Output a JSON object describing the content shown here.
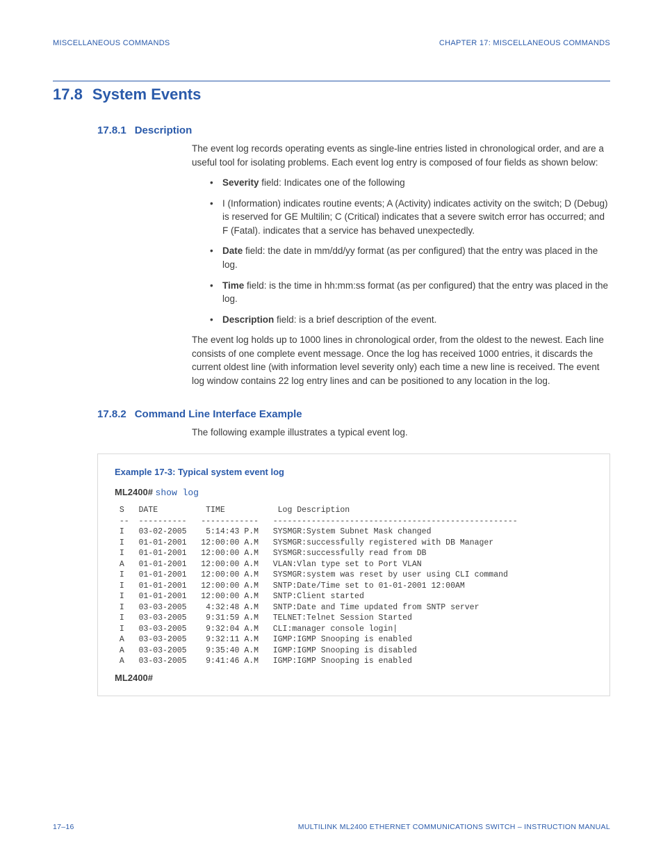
{
  "header": {
    "left": "MISCELLANEOUS COMMANDS",
    "right": "CHAPTER 17: MISCELLANEOUS COMMANDS"
  },
  "section": {
    "number": "17.8",
    "title": "System Events"
  },
  "sub1": {
    "number": "17.8.1",
    "title": "Description",
    "para1": "The event log records operating events as single-line entries listed in chronological order, and are a useful tool for isolating problems. Each event log entry is composed of four fields as shown below:",
    "bullets": [
      {
        "bold": "Severity",
        "rest": " field: Indicates one of the following"
      },
      {
        "bold": "",
        "rest": "I (Information) indicates routine events; A (Activity) indicates activity on the switch; D (Debug) is reserved for GE Multilin; C (Critical) indicates that a severe switch error has occurred; and F (Fatal). indicates that a service has behaved unexpectedly."
      },
      {
        "bold": "Date",
        "rest": " field: the date in mm/dd/yy format (as per configured) that the entry was placed in the log."
      },
      {
        "bold": "Time",
        "rest": " field: is the time in hh:mm:ss format (as per configured) that the entry was placed in the log."
      },
      {
        "bold": "Description",
        "rest": " field: is a brief description of the event."
      }
    ],
    "para2": "The event log holds up to 1000 lines in chronological order, from the oldest to the newest. Each line consists of one complete event message. Once the log has received 1000 entries, it discards the current oldest line (with information level severity only) each time a new line is received. The event log window contains 22 log entry lines and can be positioned to any location in the log."
  },
  "sub2": {
    "number": "17.8.2",
    "title": "Command Line Interface Example",
    "para1": "The following example illustrates a typical event log."
  },
  "example": {
    "title": "Example 17-3: Typical system event log",
    "prompt": "ML2400#",
    "command": "show log",
    "log": " S   DATE          TIME           Log Description\n --  ----------   ------------   ---------------------------------------------------\n I   03-02-2005    5:14:43 P.M   SYSMGR:System Subnet Mask changed\n I   01-01-2001   12:00:00 A.M   SYSMGR:successfully registered with DB Manager\n I   01-01-2001   12:00:00 A.M   SYSMGR:successfully read from DB\n A   01-01-2001   12:00:00 A.M   VLAN:Vlan type set to Port VLAN\n I   01-01-2001   12:00:00 A.M   SYSMGR:system was reset by user using CLI command\n I   01-01-2001   12:00:00 A.M   SNTP:Date/Time set to 01-01-2001 12:00AM\n I   01-01-2001   12:00:00 A.M   SNTP:Client started\n I   03-03-2005    4:32:48 A.M   SNTP:Date and Time updated from SNTP server\n I   03-03-2005    9:31:59 A.M   TELNET:Telnet Session Started\n I   03-03-2005    9:32:04 A.M   CLI:manager console login|\n A   03-03-2005    9:32:11 A.M   IGMP:IGMP Snooping is enabled\n A   03-03-2005    9:35:40 A.M   IGMP:IGMP Snooping is disabled\n A   03-03-2005    9:41:46 A.M   IGMP:IGMP Snooping is enabled",
    "prompt_end": "ML2400#"
  },
  "footer": {
    "left": "17–16",
    "right": "MULTILINK ML2400 ETHERNET COMMUNICATIONS SWITCH – INSTRUCTION MANUAL"
  }
}
